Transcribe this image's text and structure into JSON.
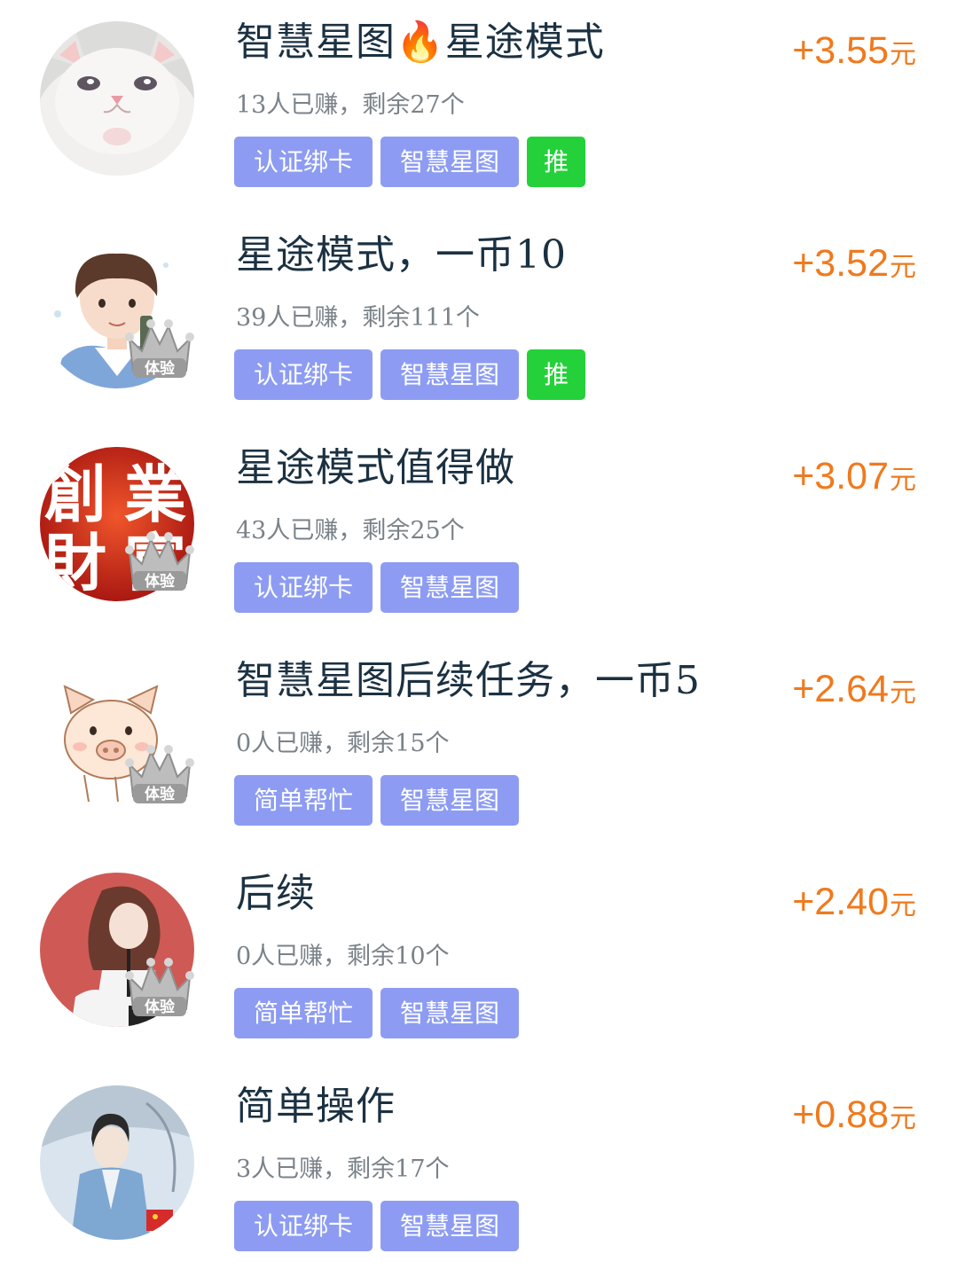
{
  "tasks": [
    {
      "title": "智慧星图🔥星途模式",
      "meta": "13人已赚，剩余27个",
      "tags": [
        "认证绑卡",
        "智慧星图",
        "推"
      ],
      "amount": "+3.55",
      "unit": "元",
      "avatar": "white-cat",
      "crown": null
    },
    {
      "title": "星途模式，一币10",
      "meta": "39人已赚，剩余111个",
      "tags": [
        "认证绑卡",
        "智慧星图",
        "推"
      ],
      "amount": "+3.52",
      "unit": "元",
      "avatar": "cartoon-boy",
      "crown": "体验"
    },
    {
      "title": "星途模式值得做",
      "meta": "43人已赚，剩余25个",
      "tags": [
        "认证绑卡",
        "智慧星图"
      ],
      "amount": "+3.07",
      "unit": "元",
      "avatar": "red-poster",
      "avatar_text": [
        "創",
        "業",
        "財",
        "富"
      ],
      "crown": "体验"
    },
    {
      "title": "智慧星图后续任务，一币5",
      "meta": "0人已赚，剩余15个",
      "tags": [
        "简单帮忙",
        "智慧星图"
      ],
      "amount": "+2.64",
      "unit": "元",
      "avatar": "cartoon-pig",
      "crown": "体验"
    },
    {
      "title": "后续",
      "meta": "0人已赚，剩余10个",
      "tags": [
        "简单帮忙",
        "智慧星图"
      ],
      "amount": "+2.40",
      "unit": "元",
      "avatar": "anime-girl",
      "crown": "体验"
    },
    {
      "title": "简单操作",
      "meta": "3人已赚，剩余17个",
      "tags": [
        "认证绑卡",
        "智慧星图"
      ],
      "amount": "+0.88",
      "unit": "元",
      "avatar": "painted-swordsman",
      "crown": null
    }
  ],
  "colors": {
    "title": "#1b3142",
    "meta": "#7a8289",
    "tag": "#8d9cf2",
    "tag_recommend": "#24d13a",
    "reward": "#ef7a1e"
  }
}
